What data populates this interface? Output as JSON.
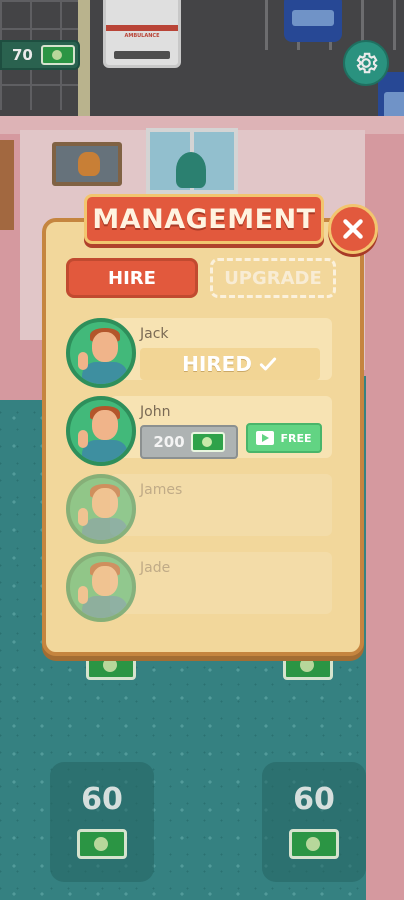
{
  "hud": {
    "money": "70",
    "settings_icon": "gear-icon"
  },
  "world": {
    "ambulance_label": "AMBULANCE",
    "slots": [
      {
        "price": "60"
      },
      {
        "price": "60"
      }
    ]
  },
  "panel": {
    "title": "MANAGEMENT",
    "close_icon": "close-icon",
    "tabs": [
      {
        "label": "HIRE",
        "active": true
      },
      {
        "label": "UPGRADE",
        "active": false
      }
    ],
    "staff": [
      {
        "name": "Jack",
        "status": "HIRED",
        "status_icon": "checkmark-icon"
      },
      {
        "name": "John",
        "price": "200",
        "free_label": "FREE"
      },
      {
        "name": "James"
      },
      {
        "name": "Jade"
      }
    ]
  },
  "colors": {
    "panel_bg": "#f2d79b",
    "accent_red": "#e2593d",
    "free_green": "#62d483",
    "avatar_green": "#42b97a"
  }
}
